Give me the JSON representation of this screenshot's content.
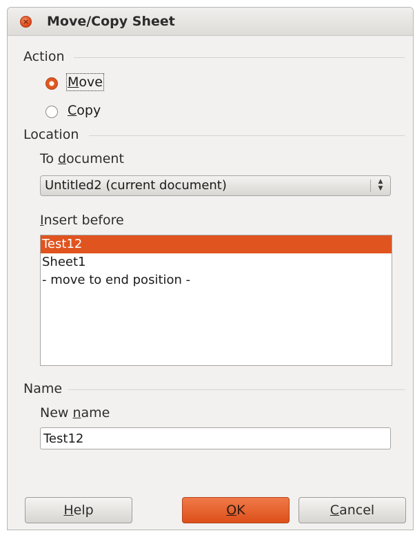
{
  "window": {
    "title": "Move/Copy Sheet",
    "close_icon": "close-icon",
    "close_glyph": "×"
  },
  "action": {
    "label": "Action",
    "options": [
      {
        "label": "Move",
        "mnemonic": "M",
        "rest": "ove",
        "checked": true
      },
      {
        "label": "Copy",
        "mnemonic": "C",
        "rest": "opy",
        "checked": false
      }
    ]
  },
  "location": {
    "label": "Location",
    "to_document": {
      "label_pre": "To ",
      "label_mnemonic": "d",
      "label_rest": "ocument",
      "value": "Untitled2 (current document)"
    },
    "insert_before": {
      "label_mnemonic": "I",
      "label_rest": "nsert before",
      "items": [
        "Test12",
        "Sheet1",
        "- move to end position -"
      ],
      "selected_index": 0
    }
  },
  "name": {
    "label": "Name",
    "new_name": {
      "label_pre": "New ",
      "label_mnemonic": "n",
      "label_rest": "ame",
      "value": "Test12"
    }
  },
  "buttons": {
    "help": {
      "mnemonic": "H",
      "rest": "elp"
    },
    "ok": {
      "mnemonic": "O",
      "rest": "K"
    },
    "cancel": {
      "mnemonic": "C",
      "rest": "ancel"
    }
  },
  "colors": {
    "accent": "#e0541f",
    "window_bg": "#f2f1f0"
  }
}
